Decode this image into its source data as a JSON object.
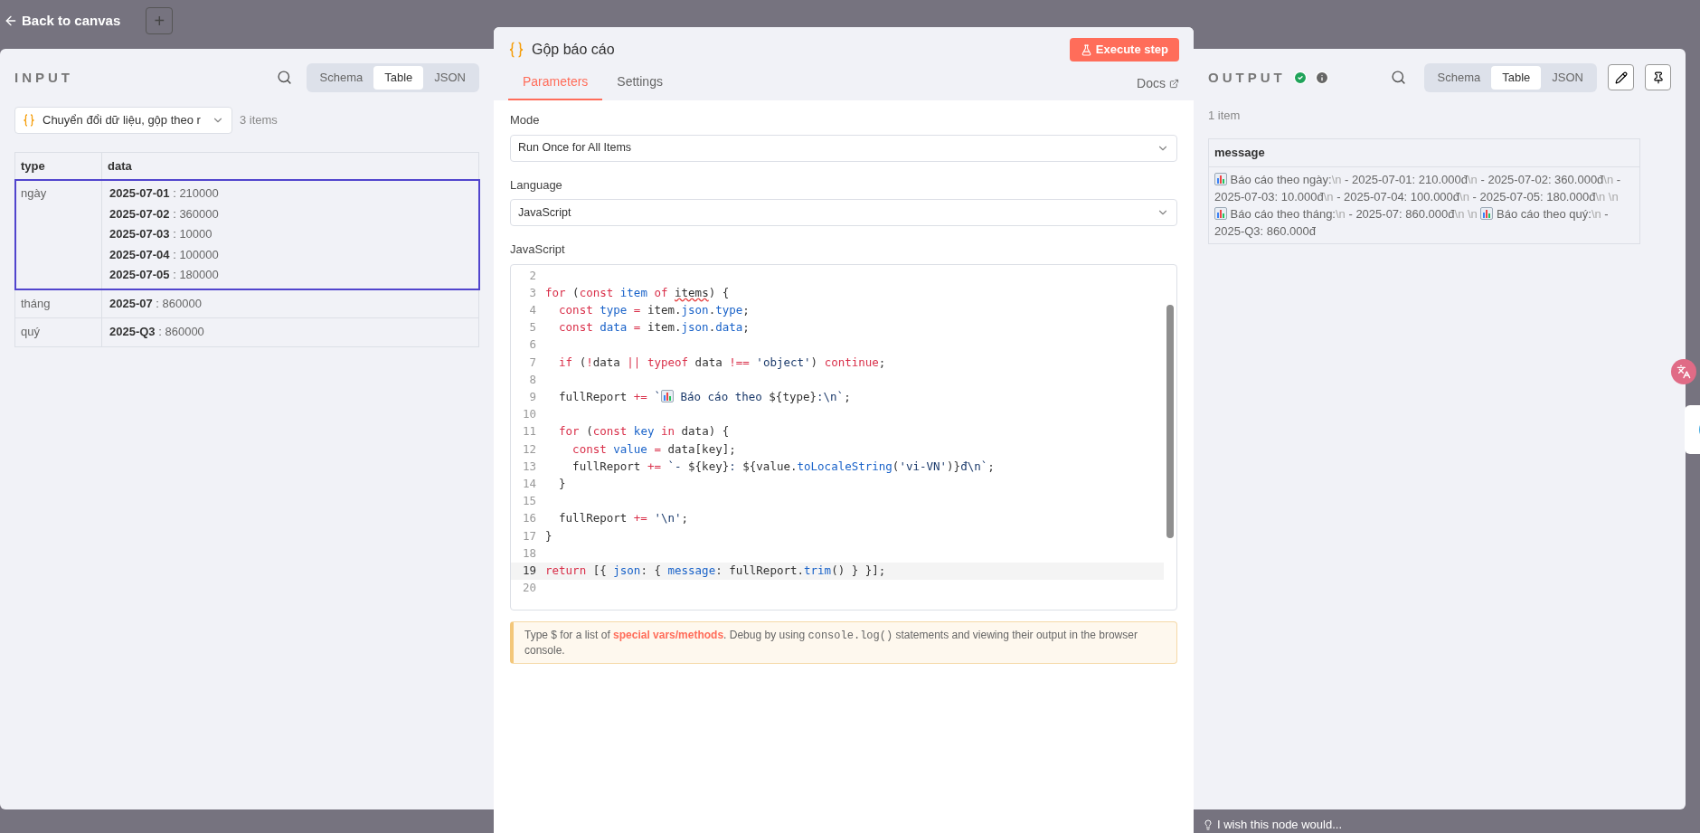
{
  "canvas": {
    "back_label": "Back to canvas",
    "add_label": "+",
    "feedback": "I wish this node would..."
  },
  "input": {
    "title": "INPUT",
    "views": [
      {
        "label": "Schema",
        "selected": false
      },
      {
        "label": "Table",
        "selected": true
      },
      {
        "label": "JSON",
        "selected": false
      }
    ],
    "source": "Chuyển đổi dữ liệu, gộp theo r",
    "count": "3 items",
    "separator": ":",
    "columns": [
      "type",
      "data"
    ],
    "rows": [
      {
        "type": "ngày",
        "selected": true,
        "data": [
          {
            "key": "2025-07-01",
            "value": "210000"
          },
          {
            "key": "2025-07-02",
            "value": "360000"
          },
          {
            "key": "2025-07-03",
            "value": "10000"
          },
          {
            "key": "2025-07-04",
            "value": "100000"
          },
          {
            "key": "2025-07-05",
            "value": "180000"
          }
        ]
      },
      {
        "type": "tháng",
        "selected": false,
        "data": [
          {
            "key": "2025-07",
            "value": "860000"
          }
        ]
      },
      {
        "type": "quý",
        "selected": false,
        "data": [
          {
            "key": "2025-Q3",
            "value": "860000"
          }
        ]
      }
    ]
  },
  "node": {
    "title": "Gộp báo cáo",
    "execute": "Execute step",
    "tabs": [
      {
        "label": "Parameters",
        "selected": true
      },
      {
        "label": "Settings",
        "selected": false
      }
    ],
    "docs": "Docs",
    "fields": [
      {
        "label": "Mode",
        "value": "Run Once for All Items"
      },
      {
        "label": "Language",
        "value": "JavaScript"
      }
    ],
    "editor_label": "JavaScript",
    "code": [
      {
        "num": "2",
        "selected": false
      },
      {
        "num": "3",
        "selected": false,
        "tokens": [
          {
            "kind": "kw",
            "text": "for"
          },
          {
            "kind": "plain",
            "text": " ("
          },
          {
            "kind": "kw",
            "text": "const"
          },
          {
            "kind": "var",
            "text": " item"
          },
          {
            "kind": "kw",
            "text": " of "
          },
          {
            "kind": "squiggle",
            "text": "items"
          },
          {
            "kind": "plain",
            "text": ") {"
          }
        ]
      },
      {
        "num": "4",
        "selected": false,
        "tokens": [
          {
            "kind": "kw",
            "text": "  const"
          },
          {
            "kind": "var",
            "text": " type"
          },
          {
            "kind": "kw",
            "text": " ="
          },
          {
            "kind": "plain",
            "text": " item."
          },
          {
            "kind": "var",
            "text": "json"
          },
          {
            "kind": "plain",
            "text": "."
          },
          {
            "kind": "var",
            "text": "type"
          },
          {
            "kind": "plain",
            "text": ";"
          }
        ]
      },
      {
        "num": "5",
        "selected": false,
        "tokens": [
          {
            "kind": "kw",
            "text": "  const"
          },
          {
            "kind": "var",
            "text": " data"
          },
          {
            "kind": "kw",
            "text": " ="
          },
          {
            "kind": "plain",
            "text": " item."
          },
          {
            "kind": "var",
            "text": "json"
          },
          {
            "kind": "plain",
            "text": "."
          },
          {
            "kind": "var",
            "text": "data"
          },
          {
            "kind": "plain",
            "text": ";"
          }
        ]
      },
      {
        "num": "6",
        "selected": false
      },
      {
        "num": "7",
        "selected": false,
        "tokens": [
          {
            "kind": "kw",
            "text": "  if"
          },
          {
            "kind": "plain",
            "text": " ("
          },
          {
            "kind": "kw",
            "text": "!"
          },
          {
            "kind": "plain",
            "text": "data "
          },
          {
            "kind": "kw",
            "text": "||"
          },
          {
            "kind": "kw",
            "text": " typeof"
          },
          {
            "kind": "plain",
            "text": " data "
          },
          {
            "kind": "kw",
            "text": "!=="
          },
          {
            "kind": "str",
            "text": " 'object'"
          },
          {
            "kind": "plain",
            "text": ") "
          },
          {
            "kind": "kw",
            "text": "continue"
          },
          {
            "kind": "plain",
            "text": ";"
          }
        ]
      },
      {
        "num": "8",
        "selected": false
      },
      {
        "num": "9",
        "selected": false,
        "tokens": [
          {
            "kind": "plain",
            "text": "  fullReport "
          },
          {
            "kind": "kw",
            "text": "+="
          },
          {
            "kind": "str",
            "text": " `"
          },
          {
            "kind": "icon"
          },
          {
            "kind": "str",
            "text": " Báo cáo theo "
          },
          {
            "kind": "plain",
            "text": "${type}"
          },
          {
            "kind": "str",
            "text": ":\\n`"
          },
          {
            "kind": "plain",
            "text": ";"
          }
        ]
      },
      {
        "num": "10",
        "selected": false
      },
      {
        "num": "11",
        "selected": false,
        "tokens": [
          {
            "kind": "kw",
            "text": "  for"
          },
          {
            "kind": "plain",
            "text": " ("
          },
          {
            "kind": "kw",
            "text": "const"
          },
          {
            "kind": "var",
            "text": " key"
          },
          {
            "kind": "kw",
            "text": " in"
          },
          {
            "kind": "plain",
            "text": " data) {"
          }
        ]
      },
      {
        "num": "12",
        "selected": false,
        "tokens": [
          {
            "kind": "kw",
            "text": "    const"
          },
          {
            "kind": "var",
            "text": " value"
          },
          {
            "kind": "kw",
            "text": " ="
          },
          {
            "kind": "plain",
            "text": " data[key];"
          }
        ]
      },
      {
        "num": "13",
        "selected": false,
        "tokens": [
          {
            "kind": "plain",
            "text": "    fullReport "
          },
          {
            "kind": "kw",
            "text": "+="
          },
          {
            "kind": "str",
            "text": " `- "
          },
          {
            "kind": "plain",
            "text": "${key}"
          },
          {
            "kind": "str",
            "text": ": "
          },
          {
            "kind": "plain",
            "text": "${value."
          },
          {
            "kind": "var",
            "text": "toLocaleString"
          },
          {
            "kind": "plain",
            "text": "("
          },
          {
            "kind": "str",
            "text": "'vi-VN'"
          },
          {
            "kind": "plain",
            "text": ")}"
          },
          {
            "kind": "str",
            "text": "đ\\n`"
          },
          {
            "kind": "plain",
            "text": ";"
          }
        ]
      },
      {
        "num": "14",
        "selected": false,
        "tokens": [
          {
            "kind": "plain",
            "text": "  }"
          }
        ]
      },
      {
        "num": "15",
        "selected": false
      },
      {
        "num": "16",
        "selected": false,
        "tokens": [
          {
            "kind": "plain",
            "text": "  fullReport "
          },
          {
            "kind": "kw",
            "text": "+="
          },
          {
            "kind": "str",
            "text": " '\\n'"
          },
          {
            "kind": "plain",
            "text": ";"
          }
        ]
      },
      {
        "num": "17",
        "selected": false,
        "tokens": [
          {
            "kind": "plain",
            "text": "}"
          }
        ]
      },
      {
        "num": "18",
        "selected": false
      },
      {
        "num": "19",
        "selected": true,
        "tokens": [
          {
            "kind": "kw",
            "text": "return"
          },
          {
            "kind": "plain",
            "text": " [{ "
          },
          {
            "kind": "var",
            "text": "json"
          },
          {
            "kind": "plain",
            "text": ": { "
          },
          {
            "kind": "var",
            "text": "message"
          },
          {
            "kind": "plain",
            "text": ": fullReport."
          },
          {
            "kind": "var",
            "text": "trim"
          },
          {
            "kind": "plain",
            "text": "() } }];"
          }
        ]
      },
      {
        "num": "20",
        "selected": false
      }
    ],
    "hint": [
      {
        "kind": "plain",
        "text": "Type $ for a list of "
      },
      {
        "kind": "link",
        "text": "special vars/methods"
      },
      {
        "kind": "plain",
        "text": ". Debug by using "
      },
      {
        "kind": "code",
        "text": "console.log()"
      },
      {
        "kind": "plain",
        "text": " statements and viewing their output in the browser console."
      }
    ]
  },
  "output": {
    "title": "OUTPUT",
    "views": [
      {
        "label": "Schema",
        "selected": false
      },
      {
        "label": "Table",
        "selected": true
      },
      {
        "label": "JSON",
        "selected": false
      }
    ],
    "count": "1 item",
    "column": "message",
    "message": [
      {
        "kind": "icon"
      },
      {
        "kind": "text",
        "text": " Báo cáo theo ngày:"
      },
      {
        "kind": "escape",
        "text": "\\n"
      },
      {
        "kind": "text",
        "text": " - 2025-07-01: 210.000đ"
      },
      {
        "kind": "escape",
        "text": "\\n"
      },
      {
        "kind": "text",
        "text": " - 2025-07-02: 360.000đ"
      },
      {
        "kind": "escape",
        "text": "\\n"
      },
      {
        "kind": "text",
        "text": " - 2025-07-03: 10.000đ"
      },
      {
        "kind": "escape",
        "text": "\\n"
      },
      {
        "kind": "text",
        "text": " - 2025-07-04: 100.000đ"
      },
      {
        "kind": "escape",
        "text": "\\n"
      },
      {
        "kind": "text",
        "text": " - 2025-07-05: 180.000đ"
      },
      {
        "kind": "escape",
        "text": "\\n \\n "
      },
      {
        "kind": "icon"
      },
      {
        "kind": "text",
        "text": " Báo cáo theo tháng:"
      },
      {
        "kind": "escape",
        "text": "\\n"
      },
      {
        "kind": "text",
        "text": " - 2025-07: 860.000đ"
      },
      {
        "kind": "escape",
        "text": "\\n \\n "
      },
      {
        "kind": "icon"
      },
      {
        "kind": "text",
        "text": " Báo cáo theo quý:"
      },
      {
        "kind": "escape",
        "text": "\\n"
      },
      {
        "kind": "text",
        "text": " - 2025-Q3: 860.000đ"
      }
    ]
  }
}
